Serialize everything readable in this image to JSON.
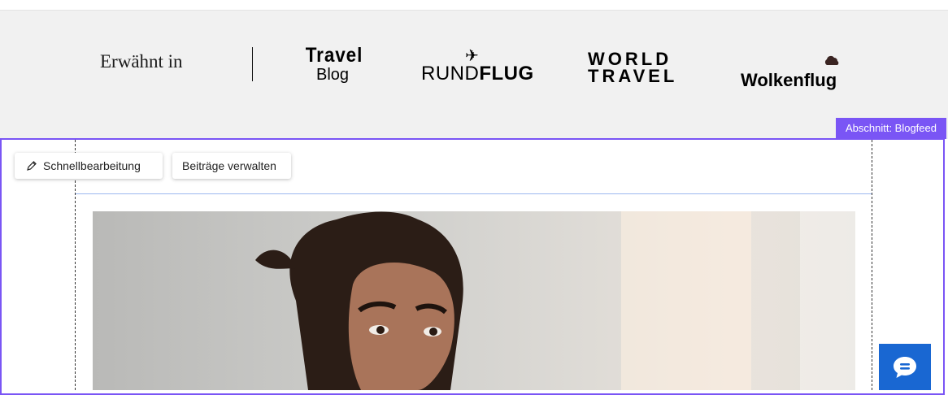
{
  "mentions": {
    "title": "Erwähnt in",
    "logos": {
      "travel_line1": "Travel",
      "travel_line2": "Blog",
      "rundflug_thin": "RUND",
      "rundflug_bold": "FLUG",
      "world_line1": "WORLD",
      "world_line2": "TRAVEL",
      "wolkenflug": "Wolkenflug"
    }
  },
  "section": {
    "label": "Abschnitt: Blogfeed"
  },
  "toolbar": {
    "quick_edit_label": "Schnellbearbeitung",
    "manage_posts_label": "Beiträge verwalten"
  },
  "colors": {
    "accent": "#7a55f5",
    "chat": "#1967d2",
    "guide": "#9db8f0"
  },
  "icons": [
    "pencil-icon",
    "airplane-icon",
    "cloud-icon",
    "chat-icon"
  ]
}
